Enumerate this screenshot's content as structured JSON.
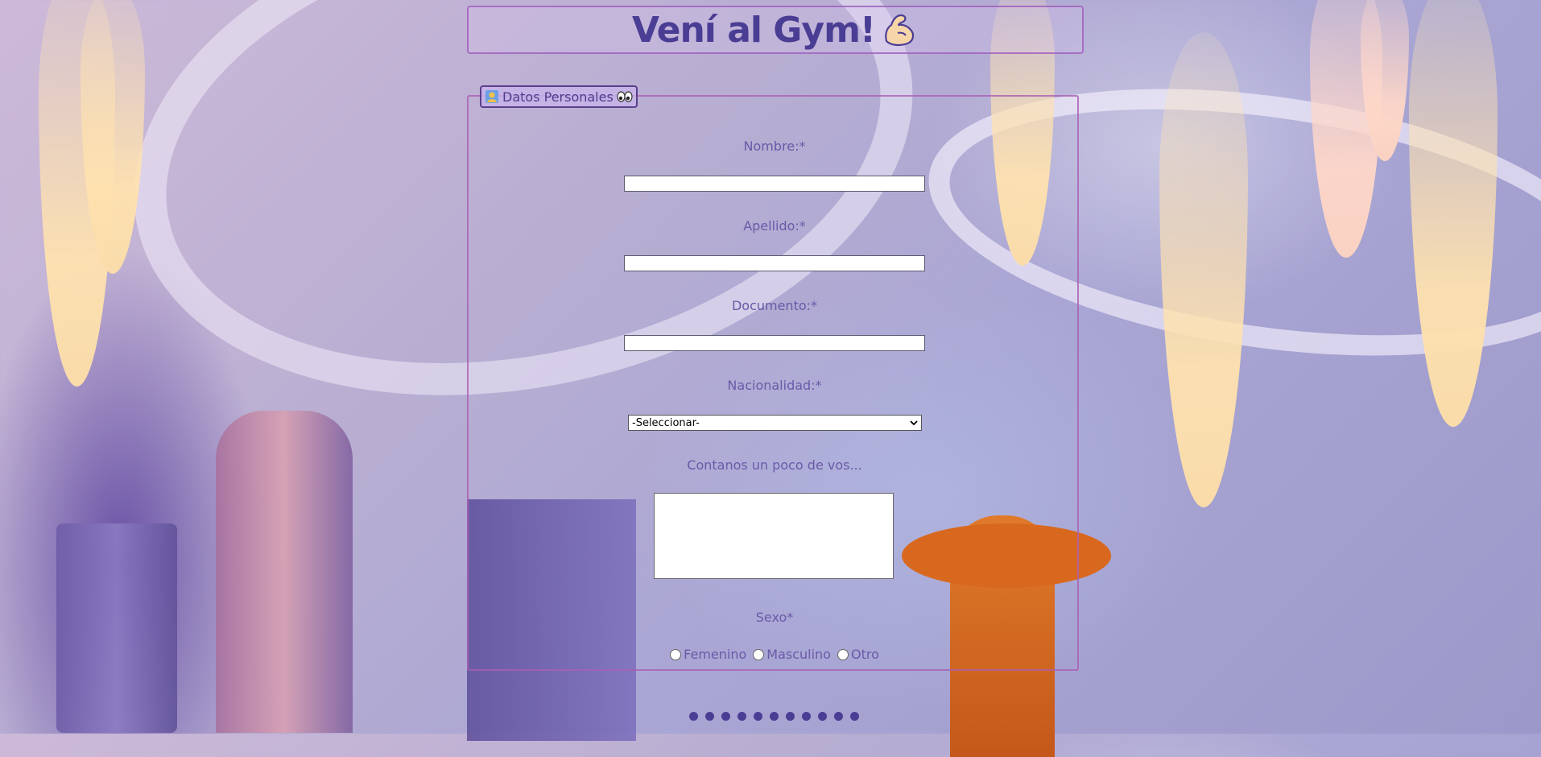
{
  "page": {
    "title": "Vení al Gym!",
    "title_icon": "flexed-biceps-icon"
  },
  "form": {
    "legend": {
      "label": "Datos Personales",
      "left_icon": "person-icon",
      "right_icon": "eyes-icon"
    },
    "nombre": {
      "label": "Nombre:*",
      "value": ""
    },
    "apellido": {
      "label": "Apellido:*",
      "value": ""
    },
    "documento": {
      "label": "Documento:*",
      "value": ""
    },
    "nacionalidad": {
      "label": "Nacionalidad:*",
      "selected": "-Seleccionar-"
    },
    "about": {
      "label": "Contanos un poco de vos...",
      "value": ""
    },
    "sexo": {
      "label": "Sexo*",
      "options": [
        "Femenino",
        "Masculino",
        "Otro"
      ]
    }
  },
  "pagination": {
    "count": 11
  },
  "colors": {
    "accent": "#4a3d94",
    "label": "#6a5aa8",
    "border": "#aa5fb4"
  }
}
